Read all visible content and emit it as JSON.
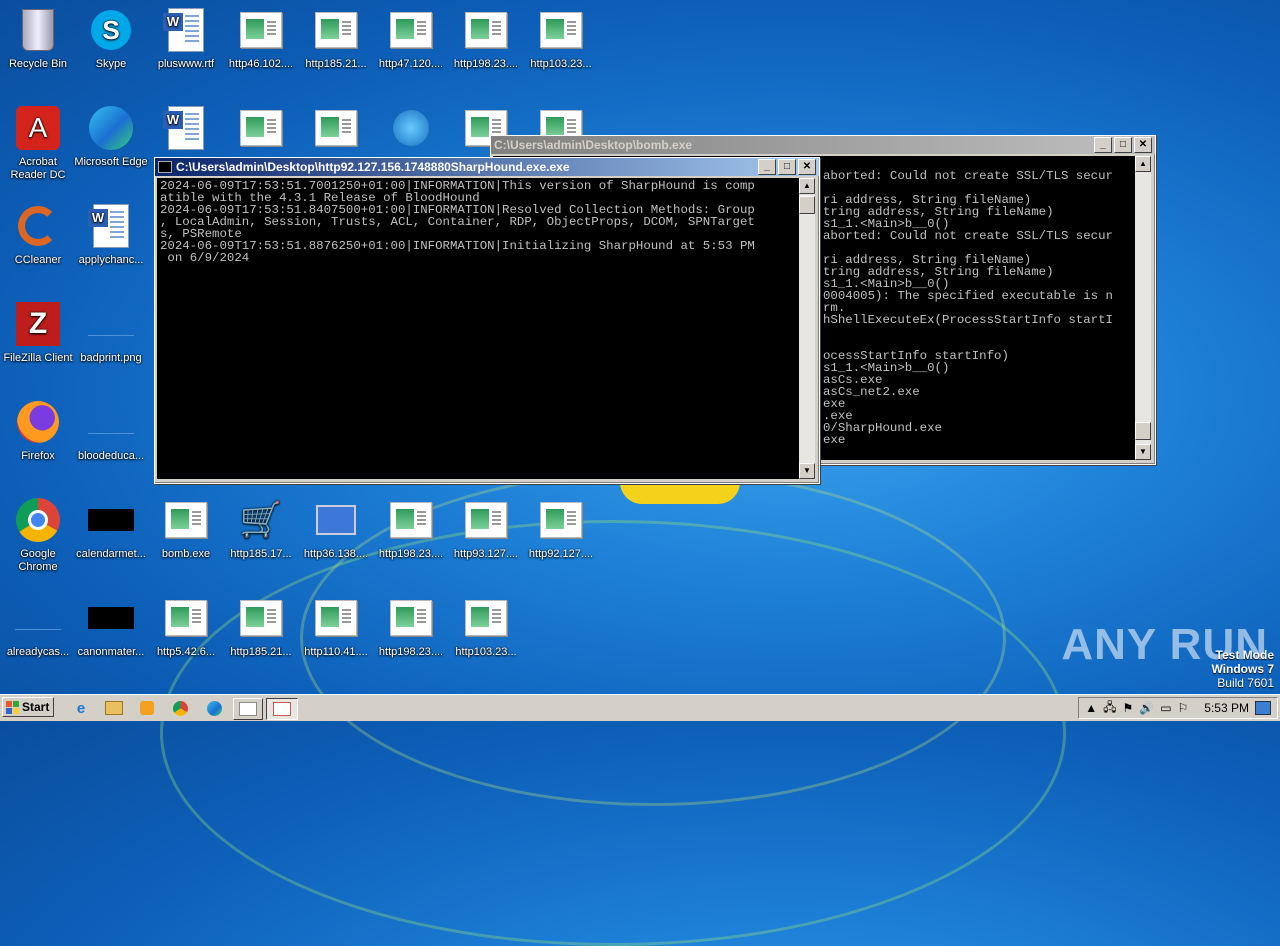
{
  "desktop": {
    "icons": [
      {
        "label": "Recycle Bin",
        "type": "recycle"
      },
      {
        "label": "Skype",
        "type": "skype"
      },
      {
        "label": "pluswww.rtf",
        "type": "doc"
      },
      {
        "label": "http46.102....",
        "type": "html"
      },
      {
        "label": "http185.21...",
        "type": "html"
      },
      {
        "label": "http47.120....",
        "type": "html"
      },
      {
        "label": "http198.23....",
        "type": "html"
      },
      {
        "label": "http103.23...",
        "type": "html"
      },
      {
        "label": "Acrobat Reader DC",
        "type": "acrobat"
      },
      {
        "label": "Microsoft Edge",
        "type": "edge"
      },
      {
        "label": "CCleaner",
        "type": "ccleaner"
      },
      {
        "label": "applychanc...",
        "type": "doc"
      },
      {
        "label": "FileZilla Client",
        "type": "filezilla"
      },
      {
        "label": "badprint.png",
        "type": "blank"
      },
      {
        "label": "Firefox",
        "type": "firefox"
      },
      {
        "label": "bloodeduca...",
        "type": "blank"
      },
      {
        "label": "Google Chrome",
        "type": "chrome"
      },
      {
        "label": "calendarmet...",
        "type": "black"
      },
      {
        "label": "bomb.exe",
        "type": "html"
      },
      {
        "label": "http185.17...",
        "type": "cart"
      },
      {
        "label": "http36.138....",
        "type": "monitor"
      },
      {
        "label": "http198.23....",
        "type": "html"
      },
      {
        "label": "http93.127....",
        "type": "html"
      },
      {
        "label": "http92.127....",
        "type": "html"
      },
      {
        "label": "alreadycas...",
        "type": "blank"
      },
      {
        "label": "canonmater...",
        "type": "black"
      },
      {
        "label": "http5.42.6...",
        "type": "html"
      },
      {
        "label": "http185.21...",
        "type": "html"
      },
      {
        "label": "http110.41....",
        "type": "html"
      },
      {
        "label": "http198.23....",
        "type": "html"
      },
      {
        "label": "http103.23...",
        "type": "html"
      }
    ],
    "hidden_row_icons": [
      "doc",
      "html",
      "html",
      "network",
      "html",
      "html"
    ]
  },
  "window_back": {
    "title": "C:\\Users\\admin\\Desktop\\bomb.exe",
    "lines": [
      "aborted: Could not create SSL/TLS secur",
      "",
      "ri address, String fileName)",
      "tring address, String fileName)",
      "s1_1.<Main>b__0()",
      "aborted: Could not create SSL/TLS secur",
      "",
      "ri address, String fileName)",
      "tring address, String fileName)",
      "s1_1.<Main>b__0()",
      "0004005): The specified executable is n",
      "rm.",
      "hShellExecuteEx(ProcessStartInfo startI",
      "",
      "",
      "ocessStartInfo startInfo)",
      "s1_1.<Main>b__0()",
      "asCs.exe",
      "asCs_net2.exe",
      "exe",
      ".exe",
      "0/SharpHound.exe",
      "exe"
    ]
  },
  "window_front": {
    "title": "C:\\Users\\admin\\Desktop\\http92.127.156.1748880SharpHound.exe.exe",
    "lines": [
      "2024-06-09T17:53:51.7001250+01:00|INFORMATION|This version of SharpHound is comp",
      "atible with the 4.3.1 Release of BloodHound",
      "2024-06-09T17:53:51.8407500+01:00|INFORMATION|Resolved Collection Methods: Group",
      ", LocalAdmin, Session, Trusts, ACL, Container, RDP, ObjectProps, DCOM, SPNTarget",
      "s, PSRemote",
      "2024-06-09T17:53:51.8876250+01:00|INFORMATION|Initializing SharpHound at 5:53 PM",
      " on 6/9/2024"
    ]
  },
  "taskbar": {
    "start_label": "Start",
    "clock": "5:53 PM"
  },
  "watermark": "ANY RUN",
  "testmode": {
    "line1": "Test Mode",
    "line2": "Windows 7",
    "line3": "Build 7601"
  },
  "colors": {
    "desktop": "#1d7fd6",
    "console_bg": "#000000",
    "console_fg": "#c0c0c0",
    "title_active": "#0a246a"
  }
}
